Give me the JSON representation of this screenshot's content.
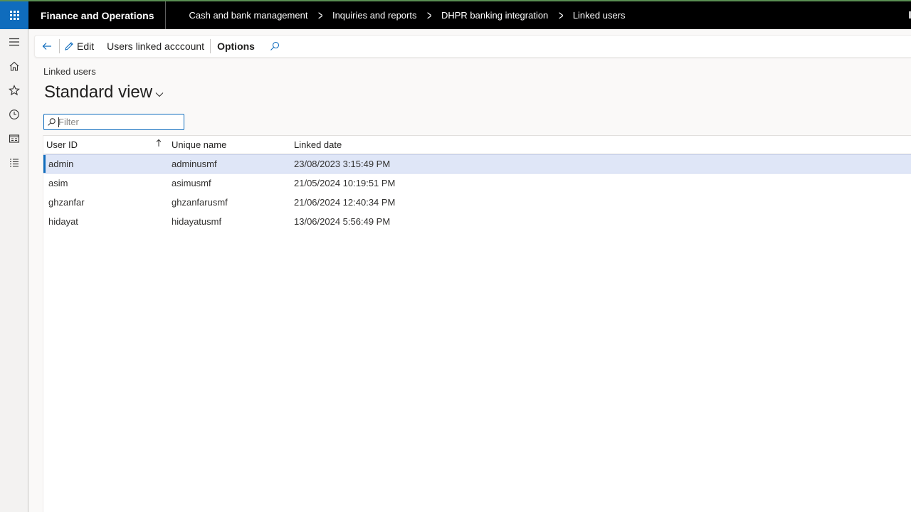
{
  "app": {
    "title": "Finance and Operations"
  },
  "breadcrumbs": [
    "Cash and bank management",
    "Inquiries and reports",
    "DHPR banking integration",
    "Linked users"
  ],
  "left_nav": {
    "items": [
      "hamburger-icon",
      "home-icon",
      "star-icon",
      "clock-icon",
      "workspace-icon",
      "list-icon"
    ]
  },
  "action_pane": {
    "edit_label": "Edit",
    "users_linked_label": "Users linked acccount",
    "options_label": "Options"
  },
  "page": {
    "caption": "Linked users",
    "view_title": "Standard view"
  },
  "filter": {
    "placeholder": "Filter",
    "value": ""
  },
  "grid": {
    "columns": [
      "User ID",
      "Unique name",
      "Linked date"
    ],
    "rows": [
      {
        "user_id": "admin",
        "unique_name": "adminusmf",
        "linked_date": "23/08/2023 3:15:49 PM"
      },
      {
        "user_id": "asim",
        "unique_name": "asimusmf",
        "linked_date": "21/05/2024 10:19:51 PM"
      },
      {
        "user_id": "ghzanfar",
        "unique_name": "ghzanfarusmf",
        "linked_date": "21/06/2024 12:40:34 PM"
      },
      {
        "user_id": "hidayat",
        "unique_name": "hidayatusmf",
        "linked_date": "13/06/2024 5:56:49 PM"
      }
    ],
    "selected_row": 0
  },
  "colors": {
    "topbar": "#000000",
    "accent": "#0f6cbd",
    "selected_row": "#dfe6f7"
  }
}
